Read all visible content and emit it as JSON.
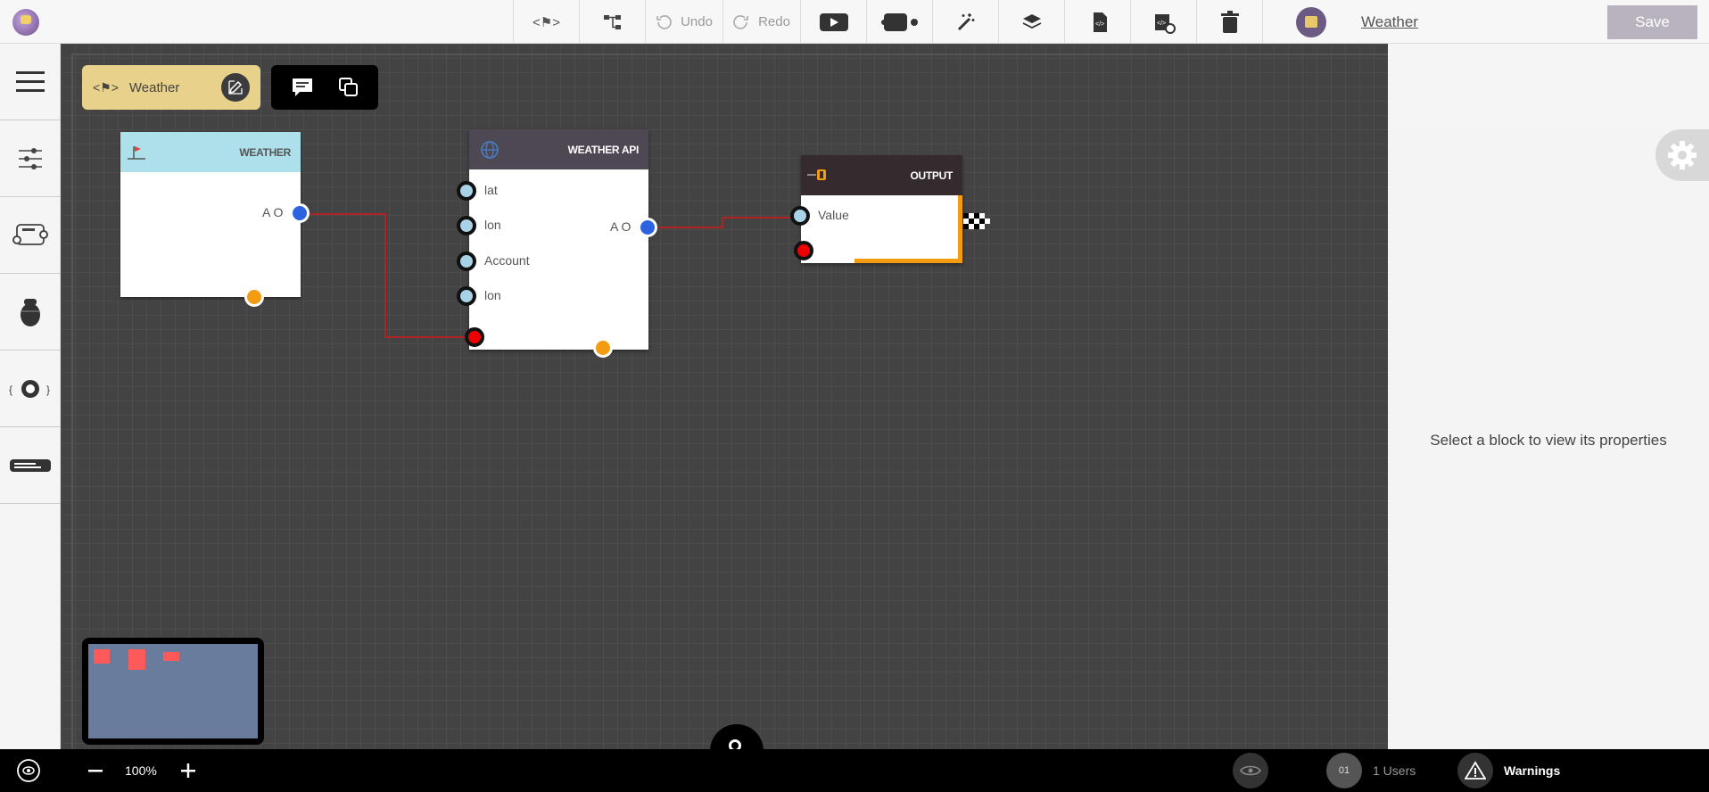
{
  "topbar": {
    "tools": [
      {
        "name": "flow-tag-tool",
        "label": "<⚑>"
      },
      {
        "name": "layout-tool"
      },
      {
        "name": "undo",
        "label": "Undo"
      },
      {
        "name": "redo",
        "label": "Redo"
      },
      {
        "name": "run-tool"
      },
      {
        "name": "debug-tool"
      },
      {
        "name": "magic-tool"
      },
      {
        "name": "layers-tool"
      },
      {
        "name": "code-tool"
      },
      {
        "name": "export-tool"
      },
      {
        "name": "delete-tool"
      }
    ],
    "document_title": "Weather",
    "save_label": "Save"
  },
  "sidebar": {
    "items": [
      "menu",
      "settings-sliders",
      "device",
      "bug",
      "api",
      "keyboard"
    ]
  },
  "flow": {
    "tag_icon": "<⚑>",
    "name": "Weather"
  },
  "blocks": {
    "weather": {
      "title": "WEATHER",
      "header_color": "#aee0ec",
      "output_label": "A O"
    },
    "weather_api": {
      "title": "WEATHER API",
      "header_color": "#4e4855",
      "inputs": [
        "lat",
        "lon",
        "Account",
        "lon"
      ],
      "output_label": "A O"
    },
    "output": {
      "title": "OUTPUT",
      "header_color": "#352a2e",
      "input_label": "Value"
    }
  },
  "properties": {
    "message": "Select a block to view its properties"
  },
  "bottombar": {
    "zoom": "100%",
    "users_badge": "01",
    "users_label": "1 Users",
    "warnings_label": "Warnings"
  },
  "colors": {
    "link": "#b22222",
    "accent_orange": "#f39c12",
    "port_blue": "#2b63e0"
  }
}
